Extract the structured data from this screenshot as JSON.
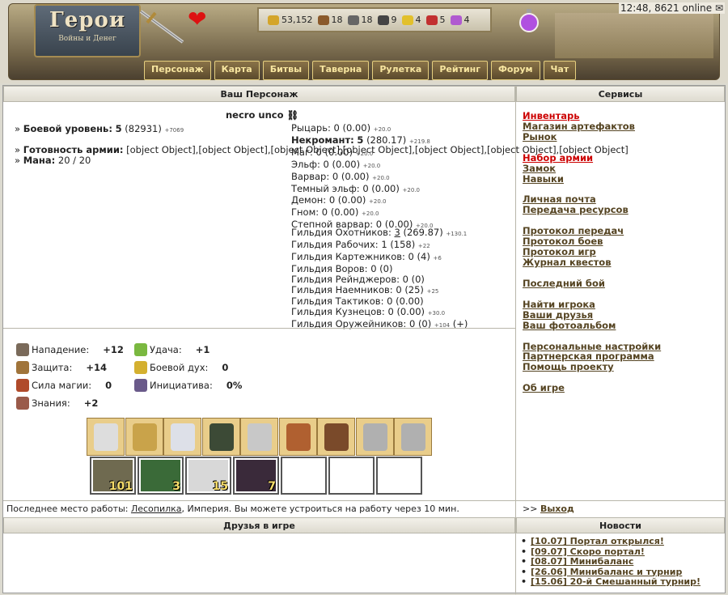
{
  "header": {
    "logo_title": "Герои",
    "logo_subtitle": "Войны и Денег",
    "clock": "12:48, 8621 online",
    "resources": [
      {
        "icon": "gold-icon",
        "value": "53,152",
        "color": "#d4a52a"
      },
      {
        "icon": "wood-icon",
        "value": "18",
        "color": "#8b5a2b"
      },
      {
        "icon": "ore-icon",
        "value": "18",
        "color": "#666666"
      },
      {
        "icon": "mercury-icon",
        "value": "9",
        "color": "#444444"
      },
      {
        "icon": "sulfur-icon",
        "value": "4",
        "color": "#e2c02b"
      },
      {
        "icon": "crystal-icon",
        "value": "5",
        "color": "#c23030"
      },
      {
        "icon": "gems-icon",
        "value": "4",
        "color": "#b05ad0"
      }
    ]
  },
  "nav": [
    "Персонаж",
    "Карта",
    "Битвы",
    "Таверна",
    "Рулетка",
    "Рейтинг",
    "Форум",
    "Чат"
  ],
  "char": {
    "caption": "Ваш Персонаж",
    "name": "necro unco",
    "level_label": "Боевой уровень:",
    "level": "5",
    "level_exp": "(82931)",
    "level_plus": "+7069",
    "army_label": "Готовность армии:",
    "army": [
      {
        "name": "footman",
        "count": "101"
      },
      {
        "name": "orc",
        "count": "3"
      },
      {
        "name": "skeleton",
        "count": "15"
      },
      {
        "name": "vampire",
        "count": "7"
      },
      {
        "name": "empty",
        "count": ""
      },
      {
        "name": "empty",
        "count": ""
      },
      {
        "name": "empty",
        "count": ""
      }
    ],
    "mana_label": "Мана:",
    "mana": "20 / 20",
    "factions": [
      {
        "name": "Рыцарь:",
        "val": "0 (0.00)",
        "plus": "+20.0"
      },
      {
        "name": "Некромант:",
        "val": "5",
        "extra": "(280.17)",
        "plus": "+219.8",
        "bold": true
      },
      {
        "name": "Маг:",
        "val": "0 (0.00)",
        "plus": "+20.0"
      },
      {
        "name": "Эльф:",
        "val": "0 (0.00)",
        "plus": "+20.0"
      },
      {
        "name": "Варвар:",
        "val": "0 (0.00)",
        "plus": "+20.0"
      },
      {
        "name": "Темный эльф:",
        "val": "0 (0.00)",
        "plus": "+20.0"
      },
      {
        "name": "Демон:",
        "val": "0 (0.00)",
        "plus": "+20.0"
      },
      {
        "name": "Гном:",
        "val": "0 (0.00)",
        "plus": "+20.0"
      },
      {
        "name": "Степной варвар:",
        "val": "0 (0.00)",
        "plus": "+20.0"
      }
    ],
    "guilds": [
      {
        "name": "Гильдия Охотников:",
        "val": "3",
        "extra": "(269.87)",
        "plus": "+130.1"
      },
      {
        "name": "Гильдия Рабочих:",
        "val": "1 (158)",
        "plus": "+22"
      },
      {
        "name": "Гильдия Картежников:",
        "val": "0 (4)",
        "plus": "+6"
      },
      {
        "name": "Гильдия Воров:",
        "val": "0 (0)",
        "plus": ""
      },
      {
        "name": "Гильдия Рейнджеров:",
        "val": "0 (0)",
        "plus": ""
      },
      {
        "name": "Гильдия Наемников:",
        "val": "0 (25)",
        "plus": "+25"
      },
      {
        "name": "Гильдия Тактиков:",
        "val": "0 (0.00)",
        "plus": ""
      },
      {
        "name": "Гильдия Кузнецов:",
        "val": "0 (0.00)",
        "plus": "+30.0"
      },
      {
        "name": "Гильдия Оружейников:",
        "val": "0 (0)",
        "plus": "+104"
      }
    ],
    "stats": [
      {
        "icon": "attack-icon",
        "label": "Нападение:",
        "value": "+12",
        "color": "#7a6a5a"
      },
      {
        "icon": "luck-icon",
        "label": "Удача:",
        "value": "+1",
        "color": "#7ab840"
      },
      {
        "icon": "defense-icon",
        "label": "Защита:",
        "value": "+14",
        "color": "#a0743a"
      },
      {
        "icon": "morale-icon",
        "label": "Боевой дух:",
        "value": "0",
        "color": "#d4b030"
      },
      {
        "icon": "spellpower-icon",
        "label": "Сила магии:",
        "value": "0",
        "color": "#b04a2a"
      },
      {
        "icon": "initiative-icon",
        "label": "Инициатива:",
        "value": "0%",
        "color": "#6a5a8a"
      },
      {
        "icon": "knowledge-icon",
        "label": "Знания:",
        "value": "+2",
        "color": "#9a5a4a"
      }
    ],
    "work": {
      "prefix": "Последнее место работы:",
      "place": "Лесопилка",
      "suffix": ", Империя. Вы можете устроиться на работу через 10 мин."
    }
  },
  "services": {
    "caption": "Сервисы",
    "exit_prefix": ">>",
    "exit": "Выход",
    "groups": [
      [
        "Инвентарь",
        "Магазин артефактов",
        "Рынок"
      ],
      [
        "Набор армии",
        "Замок",
        "Навыки"
      ],
      [
        "Личная почта",
        "Передача ресурсов"
      ],
      [
        "Протокол передач",
        "Протокол боев",
        "Протокол игр",
        "Журнал квестов"
      ],
      [
        "Последний бой"
      ],
      [
        "Найти игрока",
        "Ваши друзья",
        "Ваш фотоальбом"
      ],
      [
        "Персональные настройки",
        "Партнерская программа",
        "Помощь проекту"
      ],
      [
        "Об игре"
      ]
    ]
  },
  "friends": {
    "caption": "Друзья в игре"
  },
  "news": {
    "caption": "Новости",
    "items": [
      "[10.07] Портал открылся!",
      "[09.07] Скоро портал!",
      "[08.07] Минибаланс",
      "[26.06] Минибаланс и турнир",
      "[15.06] 20-й Смешанный турнир!"
    ]
  }
}
